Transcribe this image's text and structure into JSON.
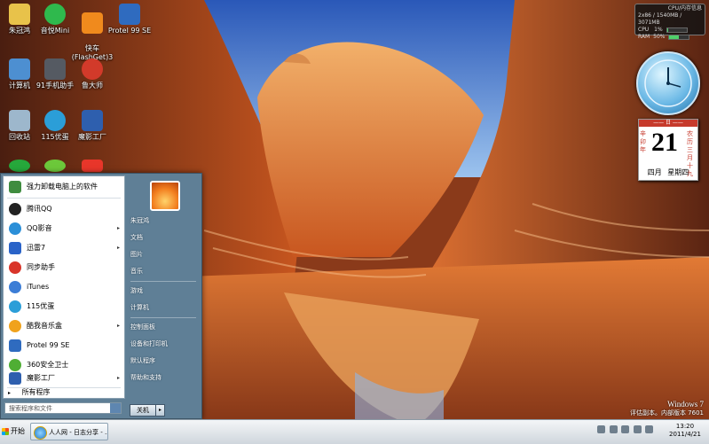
{
  "desktop": {
    "icons": [
      {
        "label": "朱冠鸿",
        "color": "#e8c24a"
      },
      {
        "label": "音悦Mini",
        "color": "#2fb94d"
      },
      {
        "label": "快车\n(FlashGet)3",
        "color": "#f08a1d"
      },
      {
        "label": "Protel 99 SE",
        "color": "#2f6bbf"
      },
      {
        "label": "计算机",
        "color": "#4d8fd1"
      },
      {
        "label": "91手机助手",
        "color": "#555a62"
      },
      {
        "label": "鲁大师",
        "color": "#d23a2a"
      },
      {
        "label": "回收站",
        "color": "#9db7cc"
      },
      {
        "label": "115优蛋",
        "color": "#2b9ed8"
      },
      {
        "label": "魔影工厂",
        "color": "#2e5fae"
      }
    ]
  },
  "widgets": {
    "cpu_title": "CPU/内存信息",
    "cpu_mem": "2x86 / 1540MB / 3071MB",
    "cpu_label": "CPU",
    "cpu_value": "1%",
    "cpu_fraction": 0.01,
    "ram_label": "RAM",
    "ram_value": "50%",
    "ram_fraction": 0.5,
    "calendar_top": "—— 日 ——",
    "calendar_day": "21",
    "calendar_left": "辛卯年",
    "calendar_month": "四月",
    "calendar_right": "农历三月十九",
    "calendar_weekday": "星期四"
  },
  "start_menu": {
    "left_items": [
      {
        "label": "强力卸载电脑上的软件",
        "color": "#3f8c3f",
        "arrow": ""
      },
      {
        "label": "腾讯QQ",
        "color": "#222222",
        "arrow": ""
      },
      {
        "label": "QQ影音",
        "color": "#2b8fd8",
        "arrow": "▸"
      },
      {
        "label": "迅雷7",
        "color": "#2a63c8",
        "arrow": "▸"
      },
      {
        "label": "同步助手",
        "color": "#d9352a",
        "arrow": ""
      },
      {
        "label": "iTunes",
        "color": "#3c7dd6",
        "arrow": ""
      },
      {
        "label": "115优蛋",
        "color": "#2b9ed8",
        "arrow": ""
      },
      {
        "label": "酷我音乐盒",
        "color": "#f0a21c",
        "arrow": "▸"
      },
      {
        "label": "Protel 99 SE",
        "color": "#2f6bbf",
        "arrow": ""
      },
      {
        "label": "360安全卫士",
        "color": "#4fae34",
        "arrow": ""
      },
      {
        "label": "魔影工厂",
        "color": "#2e5fae",
        "arrow": "▸"
      }
    ],
    "all_programs": "所有程序",
    "all_arrow": "▸",
    "search_placeholder": "搜索程序和文件",
    "right_items": [
      "朱冠鸿",
      "文档",
      "图片",
      "音乐",
      "游戏",
      "计算机",
      "控制面板",
      "设备和打印机",
      "默认程序",
      "帮助和支持"
    ],
    "shutdown": "关机",
    "shutdown_arrow": "▸"
  },
  "taskbar": {
    "start_label": "开始",
    "task_label": "人人网 - 日志分享 - ...",
    "time": "13:20",
    "date": "2011/4/21"
  },
  "watermark": {
    "line1": "Windows 7",
    "line2": "评估副本。内部版本 7601"
  }
}
